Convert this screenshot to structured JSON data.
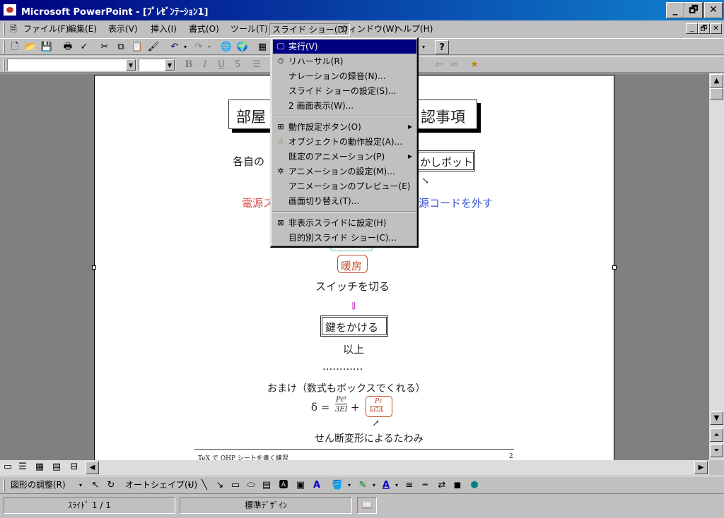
{
  "window": {
    "title": "Microsoft PowerPoint - [ﾌﾟﾚｾﾞﾝﾃｰｼｮﾝ1]",
    "minimize": "_",
    "maximize": "🗗",
    "close": "✕"
  },
  "menubar": {
    "items": [
      "ファイル(F)",
      "編集(E)",
      "表示(V)",
      "挿入(I)",
      "書式(O)",
      "ツール(T)",
      "スライド ショー(D)",
      "ウィンドウ(W)",
      "ヘルプ(H)"
    ]
  },
  "slideshow_menu": {
    "items": [
      {
        "label": "実行(V)"
      },
      {
        "label": "リハーサル(R)"
      },
      {
        "label": "ナレーションの録音(N)..."
      },
      {
        "label": "スライド ショーの設定(S)..."
      },
      {
        "label": "2 画面表示(W)..."
      },
      {
        "label": "動作設定ボタン(O)",
        "submenu": "▶"
      },
      {
        "label": "オブジェクトの動作設定(A)..."
      },
      {
        "label": "既定のアニメーション(P)",
        "submenu": "▶"
      },
      {
        "label": "アニメーションの設定(M)..."
      },
      {
        "label": "アニメーションのプレビュー(E)"
      },
      {
        "label": "画面切り替え(T)..."
      },
      {
        "label": "非表示スライドに設定(H)"
      },
      {
        "label": "目的別スライド ショー(C)..."
      }
    ]
  },
  "slide": {
    "title_left": "部屋",
    "title_right": "認事項",
    "line_left": "各自の",
    "box_right": "かしポット",
    "red_text": "電源ス",
    "blue_text": "源コードを外す",
    "heater": "暖房",
    "switch_off": "スイッチを切る",
    "arrow_down": "⇓",
    "lock": "鍵をかける",
    "end": "以上",
    "dots": "............",
    "bonus": "おまけ（数式もボックスでくれる）",
    "formula_left": "δ =",
    "formula_num": "Pℓ³",
    "formula_den": "3EI",
    "formula_plus": "+",
    "formula_box_num": "Pℓ",
    "formula_box_den": "kGA",
    "shear": "せん断変形によるたわみ",
    "footer_left": "TeX で OHP シートを書く練習",
    "footer_right": "2"
  },
  "drawing_toolbar": {
    "adjust": "図形の調整(R)",
    "autoshape": "オートシェイプ(U)"
  },
  "status": {
    "slide": "ｽﾗｲﾄﾞ 1 / 1",
    "design": "標準ﾃﾞｻﾞｲﾝ"
  }
}
